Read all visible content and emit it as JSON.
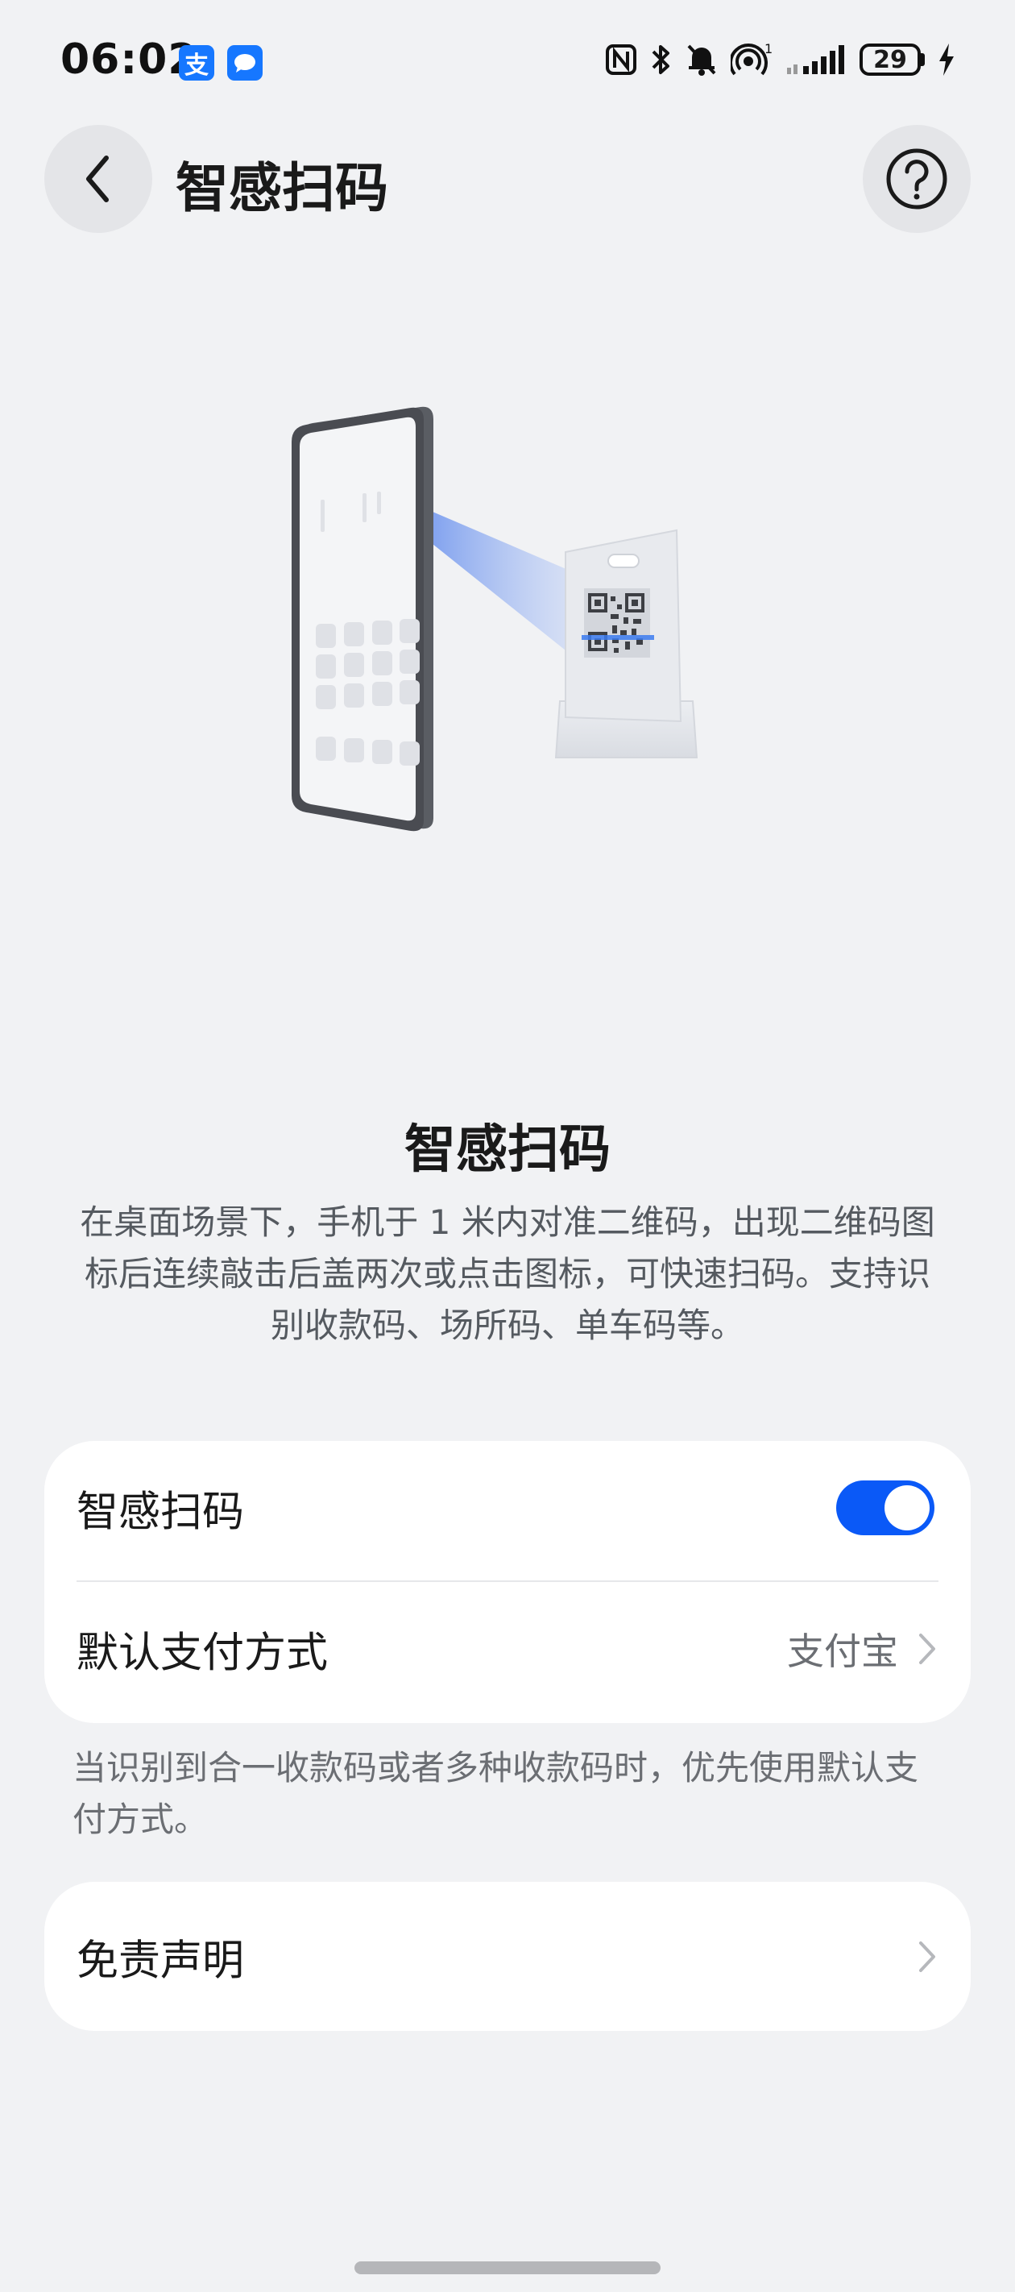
{
  "status_bar": {
    "time": "06:02",
    "alipay_badge": "支",
    "network_badge": "1",
    "battery_level": "29"
  },
  "header": {
    "title": "智感扫码"
  },
  "feature": {
    "title": "智感扫码",
    "description": "在桌面场景下，手机于 1 米内对准二维码，出现二维码图标后连续敲击后盖两次或点击图标，可快速扫码。支持识别收款码、场所码、单车码等。"
  },
  "settings": {
    "toggle_label": "智感扫码",
    "toggle_on": true,
    "payment_label": "默认支付方式",
    "payment_value": "支付宝"
  },
  "note": "当识别到合一收款码或者多种收款码时，优先使用默认支付方式。",
  "disclaimer": {
    "label": "免责声明"
  },
  "colors": {
    "accent": "#0a59f7",
    "background": "#f1f2f4"
  },
  "icons": {
    "back": "chevron-left-icon",
    "help": "question-circle-icon",
    "chevron": "chevron-right-icon"
  }
}
